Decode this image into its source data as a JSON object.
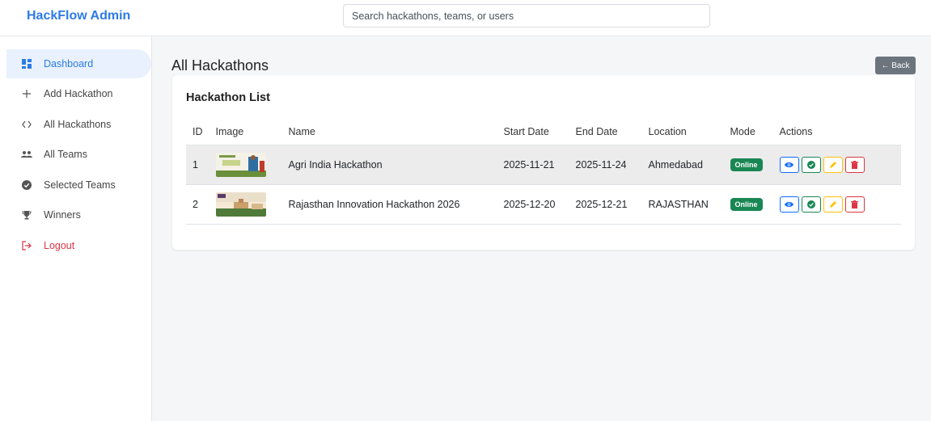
{
  "app": {
    "brand": "HackFlow Admin"
  },
  "search": {
    "placeholder": "Search hackathons, teams, or users"
  },
  "sidebar": {
    "items": [
      {
        "label": "Dashboard",
        "icon": "dashboard-icon",
        "active": true
      },
      {
        "label": "Add Hackathon",
        "icon": "plus-icon"
      },
      {
        "label": "All Hackathons",
        "icon": "code-icon"
      },
      {
        "label": "All Teams",
        "icon": "users-icon"
      },
      {
        "label": "Selected Teams",
        "icon": "check-circle-icon"
      },
      {
        "label": "Winners",
        "icon": "trophy-icon"
      },
      {
        "label": "Logout",
        "icon": "logout-icon"
      }
    ]
  },
  "page": {
    "title": "All Hackathons",
    "back_label": "← Back"
  },
  "card": {
    "title": "Hackathon List"
  },
  "table": {
    "headers": [
      "ID",
      "Image",
      "Name",
      "Start Date",
      "End Date",
      "Location",
      "Mode",
      "Actions"
    ],
    "rows": [
      {
        "id": "1",
        "name": "Agri India Hackathon",
        "start": "2025-11-21",
        "end": "2025-11-24",
        "location": "Ahmedabad",
        "mode": "Online"
      },
      {
        "id": "2",
        "name": "Rajasthan Innovation Hackathon 2026",
        "start": "2025-12-20",
        "end": "2025-12-21",
        "location": "RAJASTHAN",
        "mode": "Online"
      }
    ]
  },
  "colors": {
    "accent": "#2c7be5",
    "success": "#198754",
    "danger": "#dc3545",
    "warning": "#ffc107",
    "secondary": "#6c757d"
  }
}
